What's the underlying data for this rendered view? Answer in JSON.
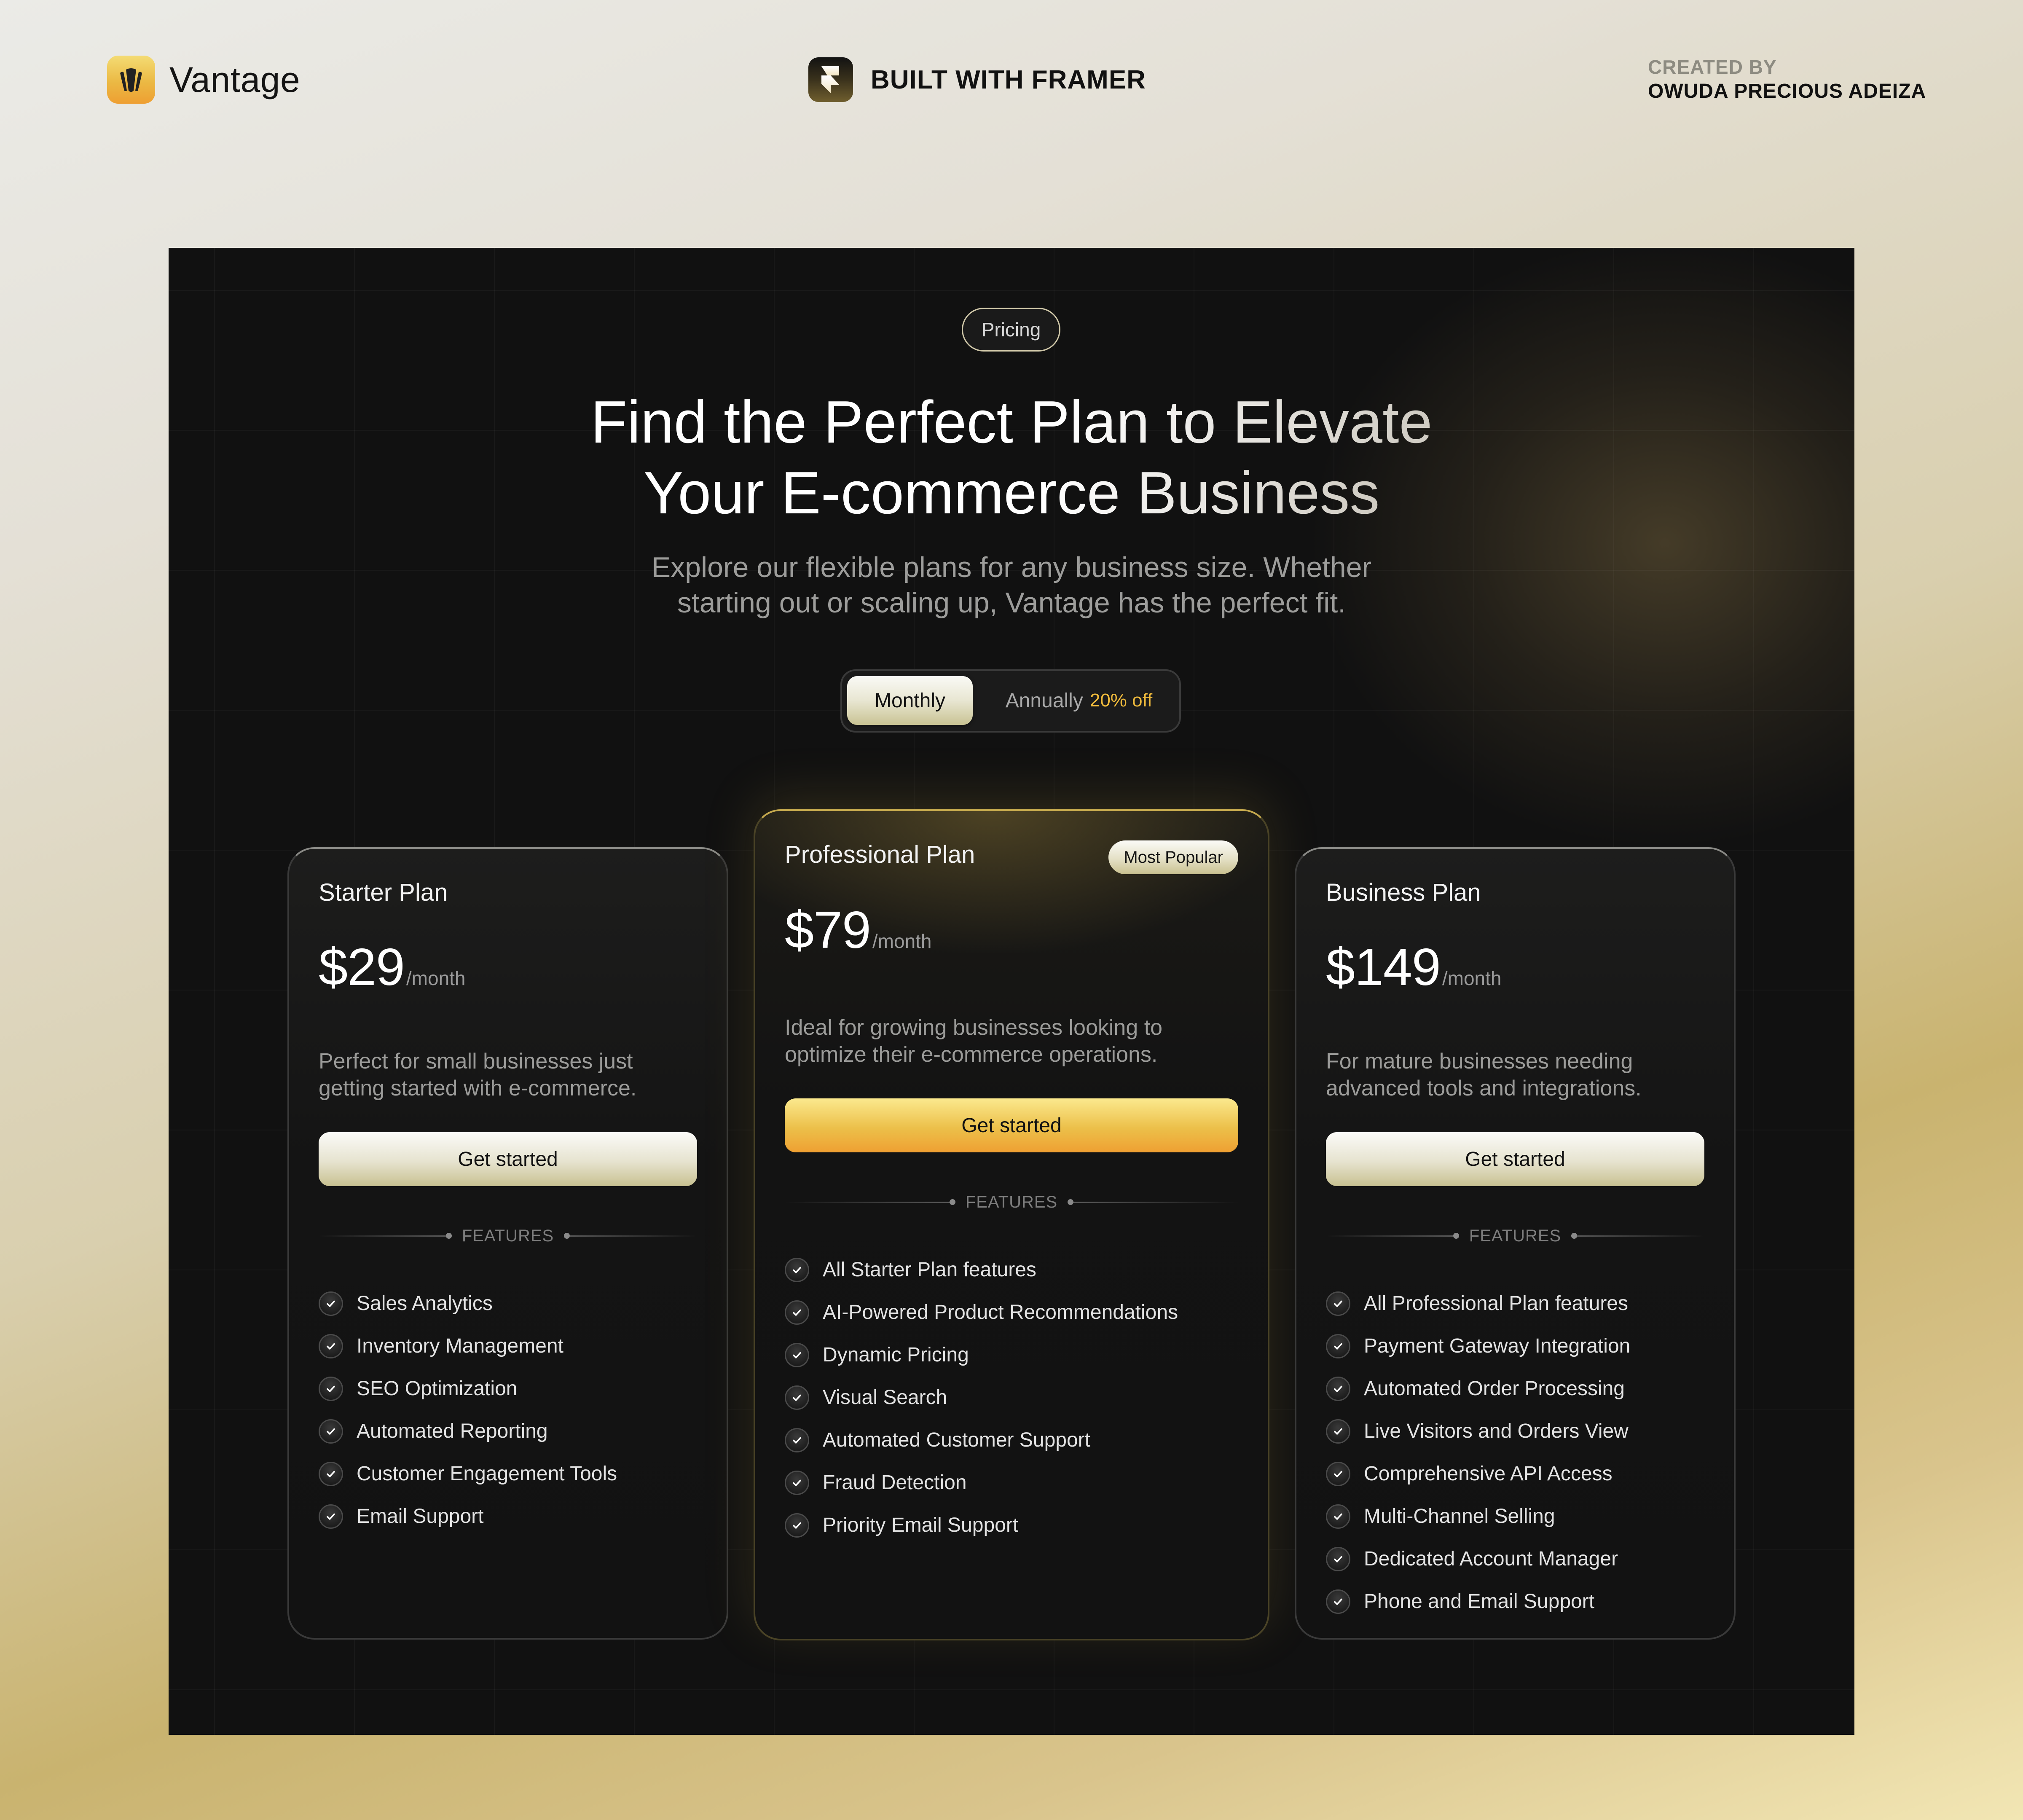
{
  "header": {
    "brand_name": "Vantage",
    "built_with": "BUILT WITH FRAMER",
    "credit_label": "CREATED BY",
    "credit_name": "OWUDA PRECIOUS ADEIZA"
  },
  "hero": {
    "pill": "Pricing",
    "title_line1": "Find the Perfect Plan to Elevate",
    "title_line2": "Your E-commerce Business",
    "subtitle_line1": "Explore our flexible plans for any business size. Whether",
    "subtitle_line2": "starting out or scaling up, Vantage has the perfect fit."
  },
  "billing_toggle": {
    "options": [
      "Monthly",
      "Annually"
    ],
    "selected": "Monthly",
    "annual_discount": "20% off"
  },
  "features_label": "FEATURES",
  "plans": [
    {
      "name": "Starter Plan",
      "price": "$29",
      "period": "/month",
      "description_line1": "Perfect for small businesses just",
      "description_line2": "getting started with e-commerce.",
      "cta": "Get started",
      "features": [
        "Sales Analytics",
        "Inventory Management",
        "SEO Optimization",
        "Automated Reporting",
        "Customer Engagement Tools",
        "Email Support"
      ]
    },
    {
      "name": "Professional Plan",
      "badge": "Most Popular",
      "price": "$79",
      "period": "/month",
      "description_line1": "Ideal for growing businesses looking to",
      "description_line2": "optimize their e-commerce operations.",
      "cta": "Get started",
      "features": [
        "All Starter Plan features",
        "AI-Powered Product Recommendations",
        "Dynamic Pricing",
        "Visual Search",
        "Automated Customer Support",
        "Fraud Detection",
        "Priority Email Support"
      ]
    },
    {
      "name": "Business Plan",
      "price": "$149",
      "period": "/month",
      "description_line1": "For mature businesses needing",
      "description_line2": "advanced tools and integrations.",
      "cta": "Get started",
      "features": [
        "All Professional Plan features",
        "Payment Gateway Integration",
        "Automated Order Processing",
        "Live Visitors and Orders View",
        "Comprehensive API Access",
        "Multi-Channel Selling",
        "Dedicated Account Manager",
        "Phone and Email Support"
      ]
    }
  ],
  "colors": {
    "accent_gold": "#f0bb3c",
    "panel_bg": "#111111",
    "cta_gold_top": "#fbe98e",
    "cta_gold_bottom": "#efa032"
  }
}
